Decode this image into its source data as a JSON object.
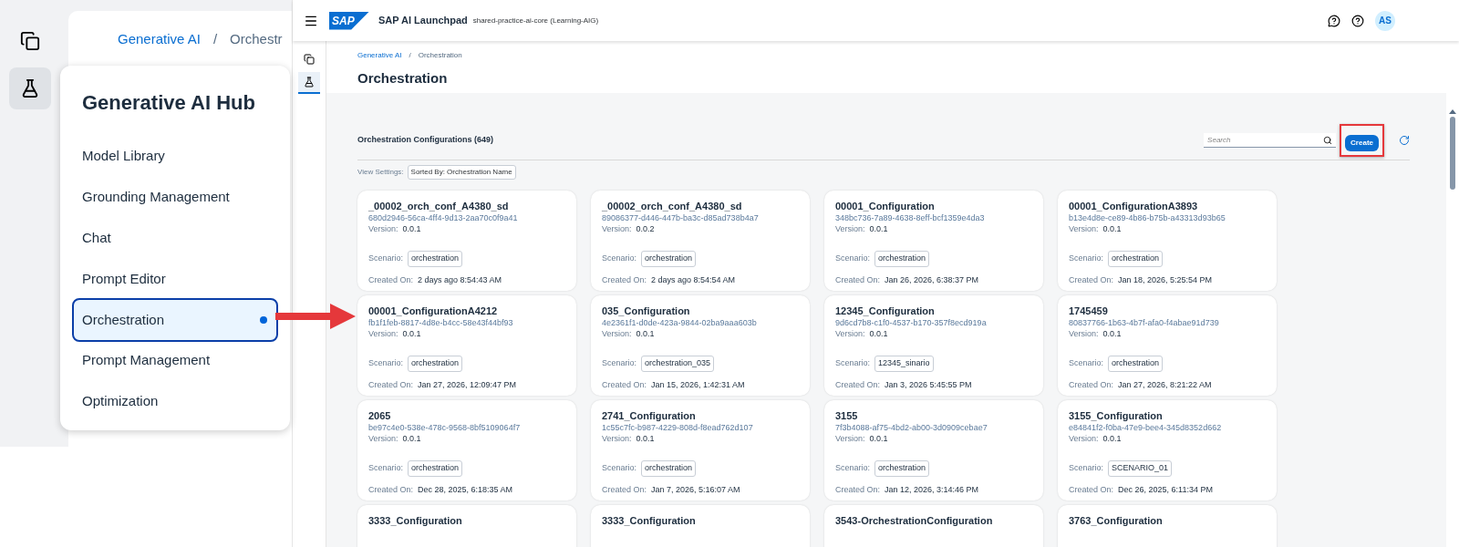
{
  "inset": {
    "breadcrumb": [
      "Generative AI",
      "Orchestr"
    ],
    "breadcrumb_separator": "/",
    "menu": {
      "title": "Generative AI Hub",
      "items": [
        {
          "label": "Model Library",
          "selected": false
        },
        {
          "label": "Grounding Management",
          "selected": false
        },
        {
          "label": "Chat",
          "selected": false
        },
        {
          "label": "Prompt Editor",
          "selected": false
        },
        {
          "label": "Orchestration",
          "selected": true
        },
        {
          "label": "Prompt Management",
          "selected": false
        },
        {
          "label": "Optimization",
          "selected": false
        }
      ]
    }
  },
  "header": {
    "logo_text": "SAP",
    "title": "SAP AI Launchpad",
    "subtitle": "shared-practice-ai-core (Learning-AIG)",
    "avatar": "AS"
  },
  "breadcrumb": [
    "Generative AI",
    "Orchestration"
  ],
  "breadcrumb_separator": "/",
  "page_title": "Orchestration",
  "section": {
    "title": "Orchestration Configurations (649)",
    "view_settings_label": "View Settings:",
    "sort_token": "Sorted By: Orchestration Name",
    "search": {
      "placeholder": "Search"
    },
    "create_button": "Create",
    "highlighted": true,
    "cards": [
      {
        "name": "_00002_orch_conf_A4380_sd",
        "id": "680d2946-56ca-4ff4-9d13-2aa70c0f9a41",
        "version_label": "Version:",
        "version": "0.0.1",
        "scenario_label": "Scenario:",
        "scenario": "orchestration",
        "created_label": "Created On:",
        "created": "2 days ago 8:54:43 AM"
      },
      {
        "name": "_00002_orch_conf_A4380_sd",
        "id": "89086377-d446-447b-ba3c-d85ad738b4a7",
        "version_label": "Version:",
        "version": "0.0.2",
        "scenario_label": "Scenario:",
        "scenario": "orchestration",
        "created_label": "Created On:",
        "created": "2 days ago 8:54:54 AM"
      },
      {
        "name": "00001_Configuration",
        "id": "348bc736-7a89-4638-8eff-bcf1359e4da3",
        "version_label": "Version:",
        "version": "0.0.1",
        "scenario_label": "Scenario:",
        "scenario": "orchestration",
        "created_label": "Created On:",
        "created": "Jan 26, 2026, 6:38:37 PM"
      },
      {
        "name": "00001_ConfigurationA3893",
        "id": "b13e4d8e-ce89-4b86-b75b-a43313d93b65",
        "version_label": "Version:",
        "version": "0.0.1",
        "scenario_label": "Scenario:",
        "scenario": "orchestration",
        "created_label": "Created On:",
        "created": "Jan 18, 2026, 5:25:54 PM"
      },
      {
        "name": "00001_ConfigurationA4212",
        "id": "fb1f1feb-8817-4d8e-b4cc-58e43f44bf93",
        "version_label": "Version:",
        "version": "0.0.1",
        "scenario_label": "Scenario:",
        "scenario": "orchestration",
        "created_label": "Created On:",
        "created": "Jan 27, 2026, 12:09:47 PM"
      },
      {
        "name": "035_Configuration",
        "id": "4e2361f1-d0de-423a-9844-02ba9aaa603b",
        "version_label": "Version:",
        "version": "0.0.1",
        "scenario_label": "Scenario:",
        "scenario": "orchestration_035",
        "created_label": "Created On:",
        "created": "Jan 15, 2026, 1:42:31 AM"
      },
      {
        "name": "12345_Configuration",
        "id": "9d6cd7b8-c1f0-4537-b170-357f8ecd919a",
        "version_label": "Version:",
        "version": "0.0.1",
        "scenario_label": "Scenario:",
        "scenario": "12345_sinario",
        "created_label": "Created On:",
        "created": "Jan 3, 2026 5:45:55 PM"
      },
      {
        "name": "1745459",
        "id": "80837766-1b63-4b7f-afa0-f4abae91d739",
        "version_label": "Version:",
        "version": "0.0.1",
        "scenario_label": "Scenario:",
        "scenario": "orchestration",
        "created_label": "Created On:",
        "created": "Jan 27, 2026, 8:21:22 AM"
      },
      {
        "name": "2065",
        "id": "be97c4e0-538e-478c-9568-8bf5109064f7",
        "version_label": "Version:",
        "version": "0.0.1",
        "scenario_label": "Scenario:",
        "scenario": "orchestration",
        "created_label": "Created On:",
        "created": "Dec 28, 2025, 6:18:35 AM"
      },
      {
        "name": "2741_Configuration",
        "id": "1c55c7fc-b987-4229-808d-f8ead762d107",
        "version_label": "Version:",
        "version": "0.0.1",
        "scenario_label": "Scenario:",
        "scenario": "orchestration",
        "created_label": "Created On:",
        "created": "Jan 7, 2026, 5:16:07 AM"
      },
      {
        "name": "3155",
        "id": "7f3b4088-af75-4bd2-ab00-3d0909cebae7",
        "version_label": "Version:",
        "version": "0.0.1",
        "scenario_label": "Scenario:",
        "scenario": "orchestration",
        "created_label": "Created On:",
        "created": "Jan 12, 2026, 3:14:46 PM"
      },
      {
        "name": "3155_Configuration",
        "id": "e84841f2-f0ba-47e9-bee4-345d8352d662",
        "version_label": "Version:",
        "version": "0.0.1",
        "scenario_label": "Scenario:",
        "scenario": "SCENARIO_01",
        "created_label": "Created On:",
        "created": "Dec 26, 2025, 6:11:34 PM"
      },
      {
        "name": "3333_Configuration"
      },
      {
        "name": "3333_Configuration"
      },
      {
        "name": "3543-OrchestrationConfiguration"
      },
      {
        "name": "3763_Configuration"
      }
    ]
  }
}
